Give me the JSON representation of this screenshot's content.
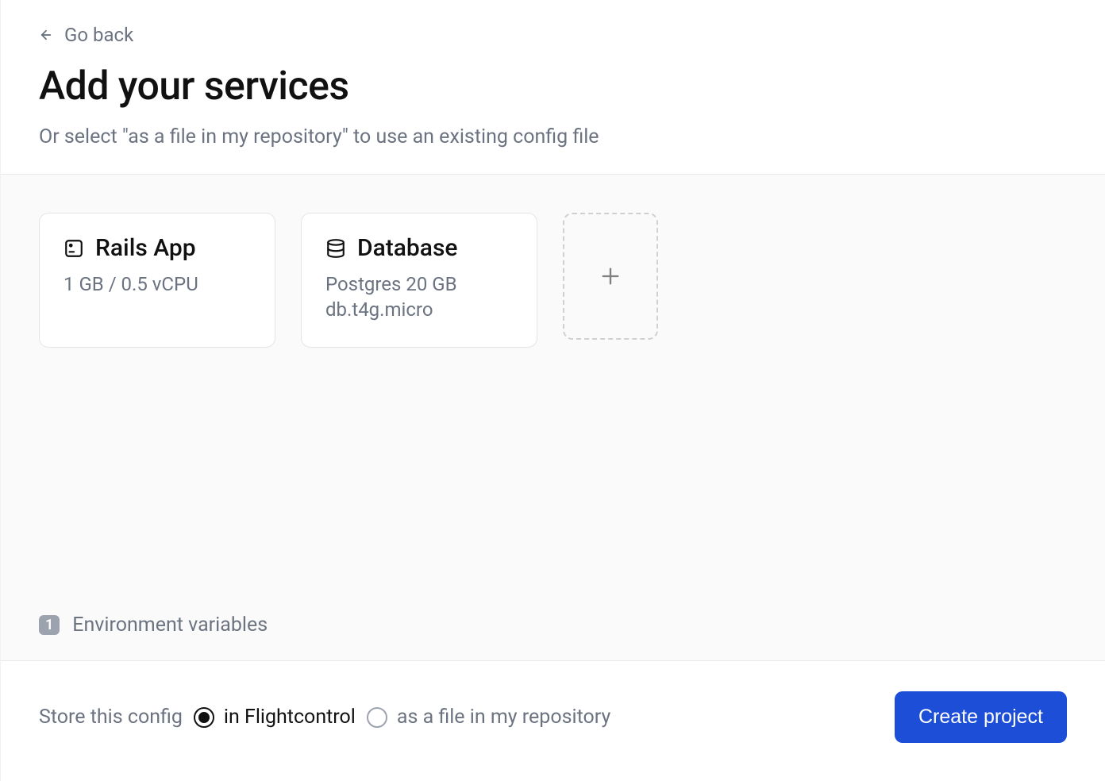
{
  "header": {
    "go_back": "Go back",
    "title": "Add your services",
    "subtitle": "Or select \"as a file in my repository\" to use an existing config file"
  },
  "services": [
    {
      "icon": "server-icon",
      "title": "Rails App",
      "subtitle": "1 GB / 0.5 vCPU"
    },
    {
      "icon": "database-icon",
      "title": "Database",
      "subtitle": "Postgres 20 GB db.t4g.micro"
    }
  ],
  "env_vars": {
    "count": "1",
    "label": "Environment variables"
  },
  "footer": {
    "store_label": "Store this config",
    "options": [
      {
        "label": "in Flightcontrol",
        "selected": true
      },
      {
        "label": "as a file in my repository",
        "selected": false
      }
    ],
    "create_button": "Create project"
  }
}
